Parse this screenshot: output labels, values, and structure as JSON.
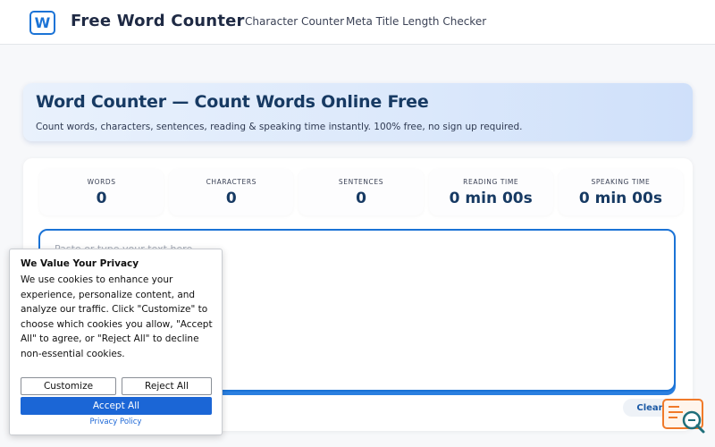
{
  "header": {
    "logo_letter": "W",
    "brand": "Free Word Counter",
    "nav": [
      "Character Counter",
      "Meta Title Length Checker"
    ]
  },
  "hero": {
    "title": "Word Counter — Count Words Online Free",
    "subtitle": "Count words, characters, sentences, reading & speaking time instantly. 100% free, no sign up required."
  },
  "stats": [
    {
      "label": "WORDS",
      "value": "0"
    },
    {
      "label": "CHARACTERS",
      "value": "0"
    },
    {
      "label": "SENTENCES",
      "value": "0"
    },
    {
      "label": "READING TIME",
      "value": "0 min 00s"
    },
    {
      "label": "SPEAKING TIME",
      "value": "0 min 00s"
    }
  ],
  "editor": {
    "placeholder": "Paste or type your text here...",
    "value": ""
  },
  "clear_label": "Clear",
  "cookie": {
    "title": "We Value Your Privacy",
    "body": "We use cookies to enhance your experience, personalize content, and analyze our traffic. Click \"Customize\" to choose which cookies you allow, \"Accept All\" to agree, or \"Reject All\" to decline non-essential cookies.",
    "customize": "Customize",
    "reject": "Reject All",
    "accept": "Accept All",
    "privacy": "Privacy Policy"
  },
  "colors": {
    "accent": "#1b73d6",
    "title": "#173a63",
    "accept": "#1b66d6",
    "widget_orange": "#f07a2a",
    "widget_teal": "#1f6f7a"
  }
}
